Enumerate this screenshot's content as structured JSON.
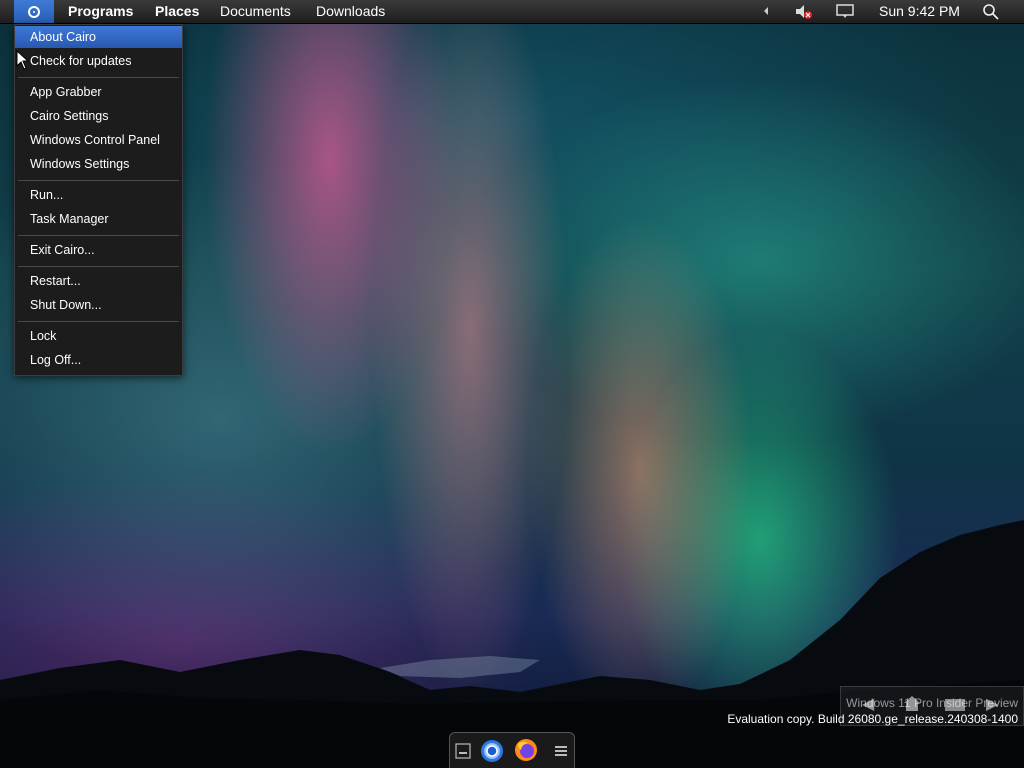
{
  "menubar": {
    "cairo_icon": "cairo-logo-icon",
    "items": [
      "Programs",
      "Places",
      "Documents",
      "Downloads"
    ],
    "tray": {
      "clock": "Sun 9:42 PM",
      "icons": [
        "chevron-left-icon",
        "speaker-muted-icon",
        "action-center-icon",
        "search-icon"
      ]
    }
  },
  "cairo_menu": {
    "items": [
      "About Cairo",
      "Check for updates",
      "App Grabber",
      "Cairo Settings",
      "Windows Control Panel",
      "Windows Settings",
      "Run...",
      "Task Manager",
      "Exit Cairo...",
      "Restart...",
      "Shut Down...",
      "Lock",
      "Log Off..."
    ],
    "highlighted": "About Cairo"
  },
  "watermark": {
    "line1": "Windows 11 Pro Insider Preview",
    "line2": "Evaluation copy. Build 26080.ge_release.240308-1400"
  },
  "dock": {
    "icons": [
      "show-desktop-icon",
      "chrome-icon",
      "firefox-icon",
      "menu-icon"
    ]
  },
  "colors": {
    "accent": "#2f6bc8",
    "menubar": "#2a2a2a",
    "menu_bg": "#1c1c1c"
  }
}
